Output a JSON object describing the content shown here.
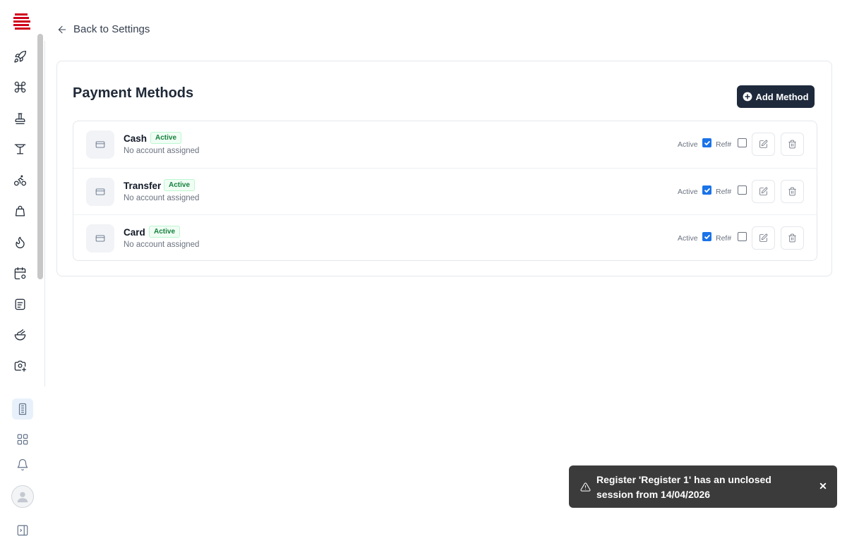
{
  "colors": {
    "brand": "#d0021b",
    "primary_button": "#1e293b",
    "active_badge_text": "#15803d",
    "active_badge_bg": "#f0fdf4",
    "checkbox_checked": "#1a73e8",
    "toast_bg": "#3b3b3b"
  },
  "sidebar": {
    "logo": "stacked-lines-logo",
    "nav_icons": [
      "rocket-icon",
      "command-icon",
      "stamp-icon",
      "table-icon",
      "bicycle-icon",
      "bag-icon",
      "flame-icon",
      "calendar-gear-icon",
      "receipt-icon",
      "bowl-icon",
      "camera-plus-icon"
    ],
    "bottom_icons": [
      "building-icon",
      "grid-icon",
      "bell-icon",
      "avatar",
      "panel-toggle-icon"
    ]
  },
  "back_link": {
    "label": "Back to Settings"
  },
  "card": {
    "title": "Payment Methods",
    "add_button_label": "Add Method"
  },
  "methods": [
    {
      "name": "Cash",
      "status": "Active",
      "account": "No account assigned",
      "active_label": "Active",
      "active_checked": true,
      "ref_label": "Ref#",
      "ref_checked": false
    },
    {
      "name": "Transfer",
      "status": "Active",
      "account": "No account assigned",
      "active_label": "Active",
      "active_checked": true,
      "ref_label": "Ref#",
      "ref_checked": false
    },
    {
      "name": "Card",
      "status": "Active",
      "account": "No account assigned",
      "active_label": "Active",
      "active_checked": true,
      "ref_label": "Ref#",
      "ref_checked": false
    }
  ],
  "toast": {
    "message": "Register 'Register 1' has an unclosed session from 14/04/2026",
    "icon": "warning-icon"
  }
}
